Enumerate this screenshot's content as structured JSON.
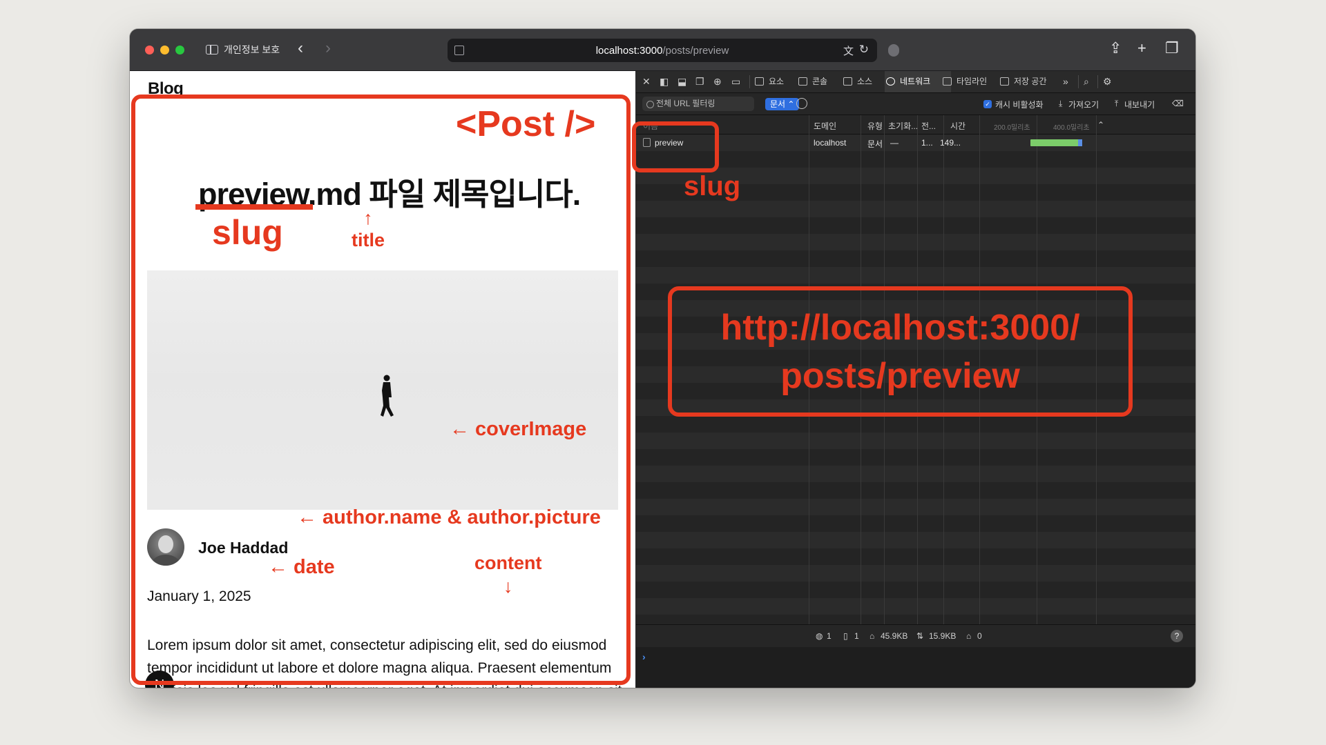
{
  "browser": {
    "sidebar_label": "개인정보 보호",
    "url_host": "localhost:3000",
    "url_path": "/posts/preview"
  },
  "page": {
    "blog_title": "Blog",
    "post_title": "preview.md 파일 제목입니다.",
    "author_name": "Joe Haddad",
    "date": "January 1, 2025",
    "body": "Lorem ipsum dolor sit amet, consectetur adipiscing elit, sed do eiusmod tempor incididunt ut labore et dolore magna aliqua. Praesent elementum facilisis leo vel fringilla est ullamcorper eget. At imperdiet dui accumsan sit amet nulla facilities morbi tempus. Praesent",
    "n_badge": "N"
  },
  "devtools": {
    "tabs": [
      "요소",
      "콘솔",
      "소스",
      "네트워크",
      "타임라인",
      "저장 공간"
    ],
    "active_tab": "네트워크",
    "filter_placeholder": "전체 URL 필터링",
    "doc_filter": "문서 ⌃",
    "cache_disable": "캐시 비활성화",
    "import_label": "가져오기",
    "export_label": "내보내기",
    "columns": {
      "name": "이름",
      "domain": "도메인",
      "type": "유형",
      "initiator": "초기화...",
      "transfer": "전...",
      "time": "시간",
      "wf_200": "200.0밀리초",
      "wf_400": "400.0밀리초"
    },
    "row": {
      "name": "preview",
      "domain": "localhost",
      "type": "문서",
      "initiator": "—",
      "transfer": "1...",
      "time": "149..."
    },
    "footer": {
      "requests": "1",
      "resources": "1",
      "size": "45.9KB",
      "transferred": "15.9KB",
      "errors": "0"
    },
    "console_prompt": "›"
  },
  "annotations": {
    "post": "<Post />",
    "slug_left": "slug",
    "title": "↑\ntitle",
    "cover": "← coverImage",
    "author": "← author.name & author.picture",
    "date": "← date",
    "content": "content\n↓",
    "slug_right": "slug",
    "url": "http://localhost:3000/\nposts/preview"
  },
  "colors": {
    "annotation": "#e6391f",
    "active_chip": "#2f6fe0",
    "waterfall": "#7ccd6a"
  }
}
